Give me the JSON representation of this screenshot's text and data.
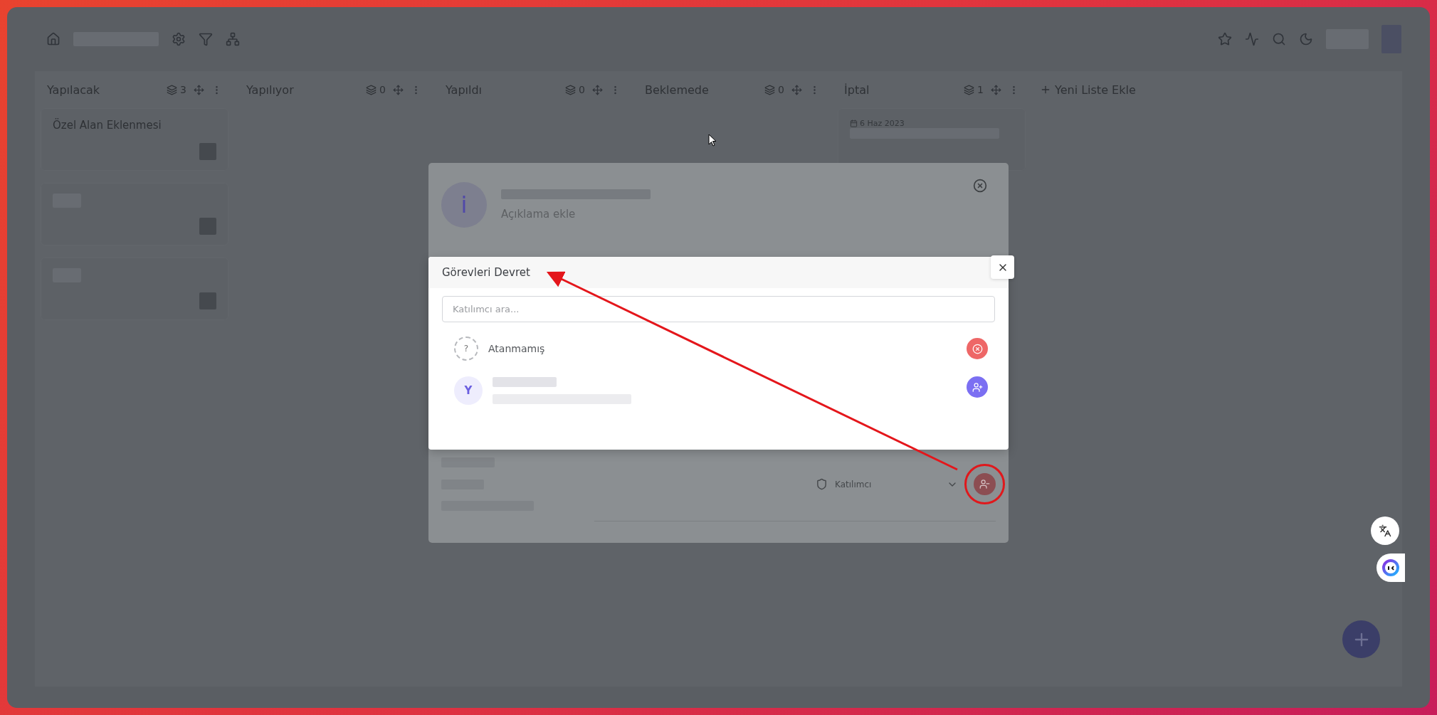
{
  "columns": [
    {
      "title": "Yapılacak",
      "count": "3",
      "cards": [
        {
          "kind": "titled",
          "title": "Özel Alan Eklenmesi"
        },
        {
          "kind": "redacted"
        },
        {
          "kind": "redacted"
        }
      ]
    },
    {
      "title": "Yapılıyor",
      "count": "0"
    },
    {
      "title": "Yapıldı",
      "count": "0"
    },
    {
      "title": "Beklemede",
      "count": "0"
    },
    {
      "title": "İptal",
      "count": "1",
      "cards": [
        {
          "kind": "dated",
          "date": "6 Haz 2023"
        }
      ]
    }
  ],
  "add_list": "Yeni Liste Ekle",
  "task_modal": {
    "avatar": "i",
    "description_placeholder": "Açıklama ekle",
    "role": "Katılımcı"
  },
  "assign_dialog": {
    "title": "Görevleri Devret",
    "search_placeholder": "Katılımcı ara...",
    "options": [
      {
        "kind": "unassigned",
        "badge": "?",
        "name": "Atanmamış"
      },
      {
        "kind": "user",
        "initial": "Y"
      }
    ]
  }
}
